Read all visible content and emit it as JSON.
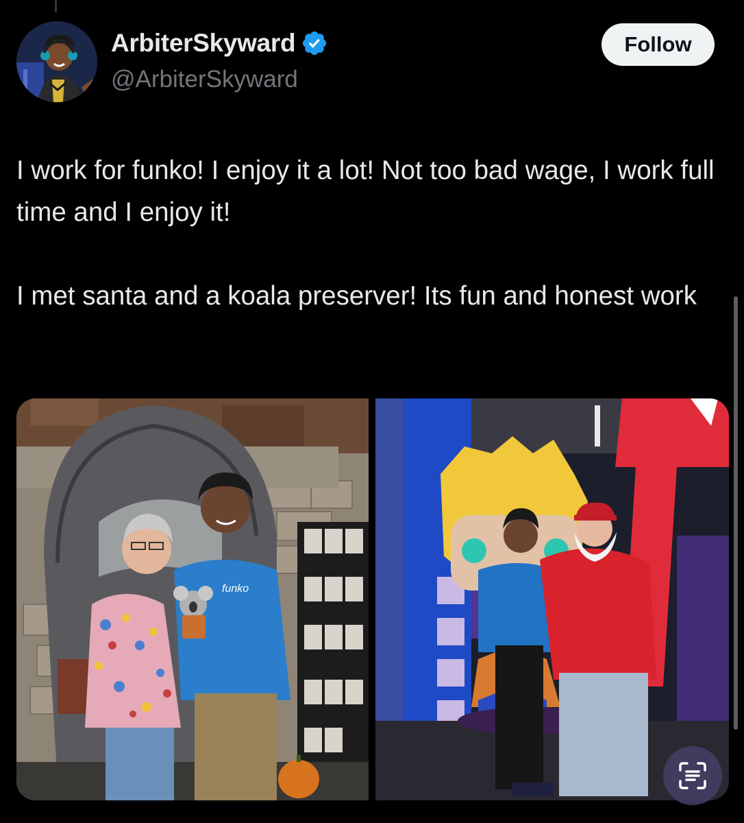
{
  "post": {
    "author": {
      "display_name": "ArbiterSkyward",
      "handle": "@ArbiterSkyward",
      "verified": true
    },
    "follow_label": "Follow",
    "text_paragraphs": [
      "I work for funko! I enjoy it a lot! Not too bad wage, I work full time and I enjoy it!",
      "I met santa and a koala preserver! Its fun and honest work"
    ]
  },
  "photos": {
    "left": {
      "shirt_text": "funko"
    }
  },
  "colors": {
    "background": "#000000",
    "text_primary": "#e7e9ea",
    "text_secondary": "#71767b",
    "verified_blue": "#1d9bf0",
    "follow_button_bg": "#eff3f4"
  },
  "icons": {
    "verified": "verified-badge-icon",
    "scan": "text-scan-icon"
  }
}
